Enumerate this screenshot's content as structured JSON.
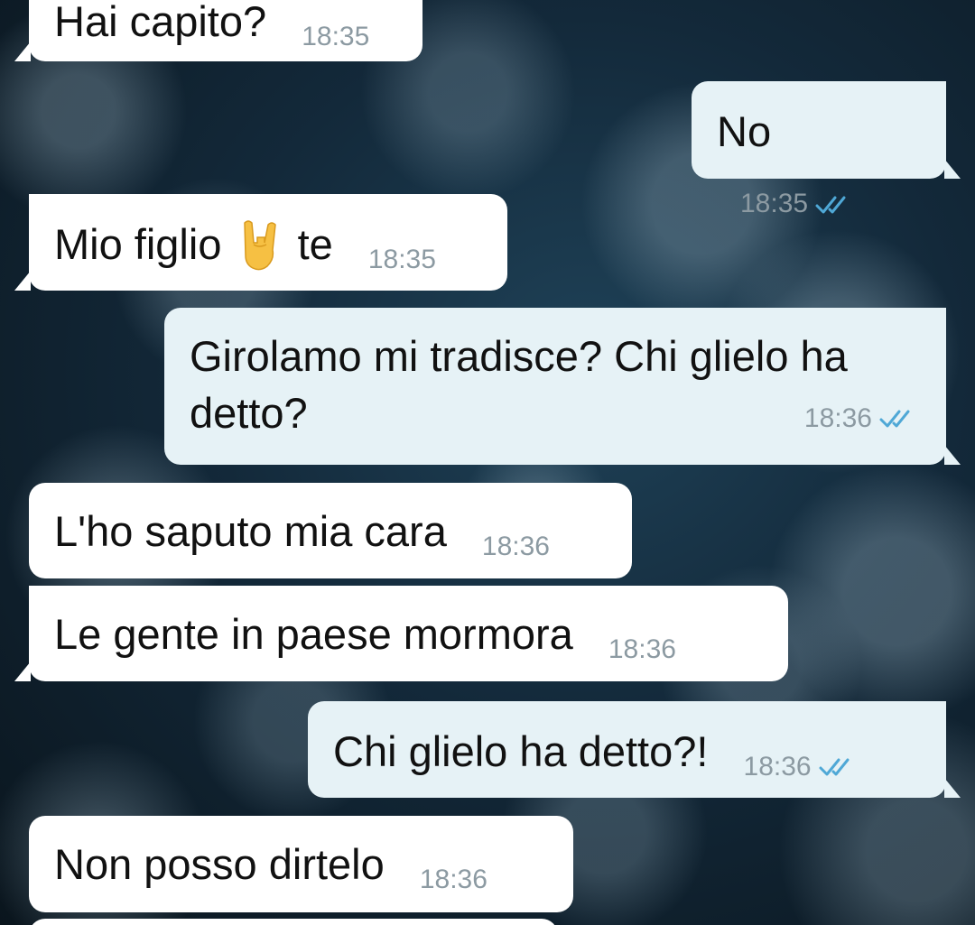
{
  "colors": {
    "incoming_bubble": "#ffffff",
    "outgoing_bubble": "#e6f2f6",
    "timestamp": "#8c9aa2",
    "read_ticks": "#4fa8d6"
  },
  "messages": [
    {
      "direction": "in",
      "text": "Hai capito?",
      "time": "18:35"
    },
    {
      "direction": "out",
      "text": "No",
      "time": "18:35",
      "status": "read"
    },
    {
      "direction": "in",
      "text_before": "Mio figlio",
      "emoji": "sign-of-the-horns",
      "text_after": "te",
      "time": "18:35"
    },
    {
      "direction": "out",
      "text": "Girolamo mi tradisce? Chi glielo ha detto?",
      "time": "18:36",
      "status": "read"
    },
    {
      "direction": "in",
      "text": "L'ho saputo mia cara",
      "time": "18:36"
    },
    {
      "direction": "in",
      "text": "Le gente in paese mormora",
      "time": "18:36"
    },
    {
      "direction": "out",
      "text": "Chi glielo ha detto?!",
      "time": "18:36",
      "status": "read"
    },
    {
      "direction": "in",
      "text": "Non posso dirtelo",
      "time": "18:36"
    }
  ]
}
